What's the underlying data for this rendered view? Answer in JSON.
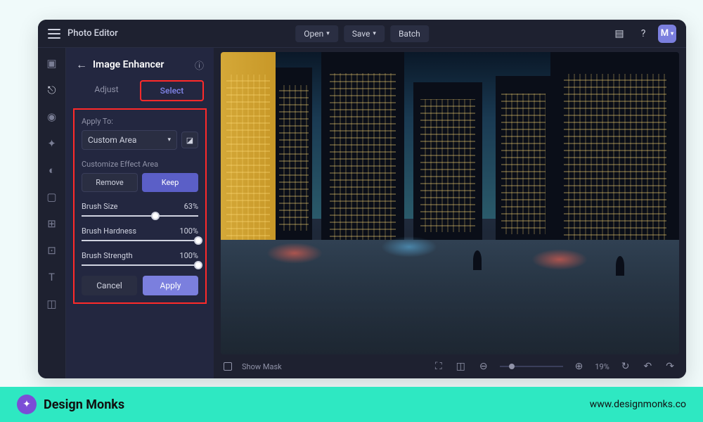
{
  "app": {
    "title": "Photo Editor"
  },
  "topbar": {
    "open": "Open",
    "save": "Save",
    "batch": "Batch",
    "avatar_letter": "M"
  },
  "panel": {
    "title": "Image Enhancer",
    "tabs": {
      "adjust": "Adjust",
      "select": "Select"
    },
    "apply_to_label": "Apply To:",
    "apply_to_value": "Custom Area",
    "customize_label": "Customize Effect Area",
    "remove": "Remove",
    "keep": "Keep",
    "sliders": {
      "brush_size": {
        "label": "Brush Size",
        "value": "63%",
        "pos": 63
      },
      "brush_hardness": {
        "label": "Brush Hardness",
        "value": "100%",
        "pos": 100
      },
      "brush_strength": {
        "label": "Brush Strength",
        "value": "100%",
        "pos": 100
      }
    },
    "cancel": "Cancel",
    "apply": "Apply"
  },
  "canvas_footer": {
    "show_mask": "Show Mask",
    "zoom": "19%"
  },
  "branding": {
    "name": "Design Monks",
    "url": "www.designmonks.co"
  }
}
